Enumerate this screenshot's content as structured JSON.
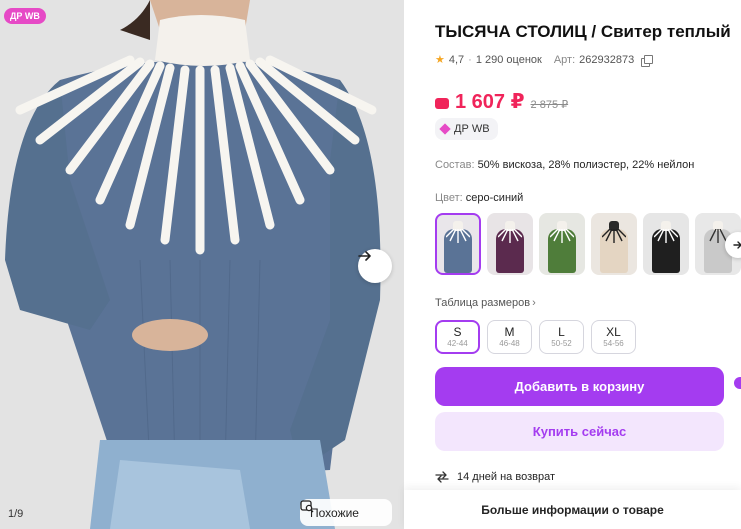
{
  "photo": {
    "badge": "ДР WB",
    "counter": "1/9",
    "similar_label": "Похожие"
  },
  "product": {
    "title": "ТЫСЯЧА СТОЛИЦ / Свитер теплый",
    "rating": "4,7",
    "reviews": "1 290 оценок",
    "article_label": "Арт:",
    "article": "262932873",
    "price": "1 607 ₽",
    "old_price": "2 875 ₽",
    "promo_chip": "ДР WB",
    "composition_label": "Состав:",
    "composition": "50% вискоза, 28% полиэстер, 22% нейлон",
    "color_label": "Цвет:",
    "color_value": "серо-синий",
    "colors": [
      "серо-синий",
      "фиолетовый",
      "зеленый",
      "бежевый",
      "черный",
      "серый"
    ],
    "size_table_label": "Таблица размеров",
    "sizes": [
      {
        "label": "S",
        "range": "42-44"
      },
      {
        "label": "M",
        "range": "46-48"
      },
      {
        "label": "L",
        "range": "50-52"
      },
      {
        "label": "XL",
        "range": "54-56"
      }
    ],
    "selected_size": "S",
    "add_to_cart": "Добавить в корзину",
    "buy_now": "Купить сейчас",
    "returns": "14 дней на возврат",
    "more_info": "Больше информации о товаре"
  },
  "theme": {
    "accent": "#a43cf0",
    "price_color": "#f0245a",
    "badge_color": "#e64ac6",
    "sweater_color": "#5a7396"
  }
}
